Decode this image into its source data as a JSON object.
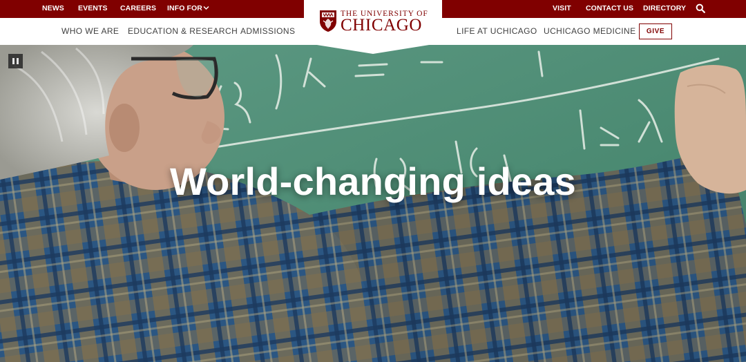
{
  "utility_nav": {
    "news": "NEWS",
    "events": "EVENTS",
    "careers": "CAREERS",
    "info_for": "INFO FOR",
    "visit": "VISIT",
    "contact_us": "CONTACT US",
    "directory": "DIRECTORY"
  },
  "main_nav": {
    "who_we_are": "WHO WE ARE",
    "education_research": "EDUCATION & RESEARCH",
    "admissions": "ADMISSIONS",
    "life_at_uchicago": "LIFE AT UCHICAGO",
    "uchicago_medicine": "UCHICAGO MEDICINE",
    "give": "GIVE"
  },
  "logo": {
    "line1": "THE UNIVERSITY OF",
    "line2": "CHICAGO"
  },
  "hero": {
    "title": "World-changing ideas"
  },
  "icons": {
    "search": "search-icon",
    "info_for_chevron": "chevron-down-icon",
    "crest": "phoenix-crest-icon",
    "pause": "pause-icon"
  },
  "colors": {
    "brand_maroon": "#800000",
    "nav_text": "#404040",
    "chalkboard_green": "#4a8a73"
  }
}
